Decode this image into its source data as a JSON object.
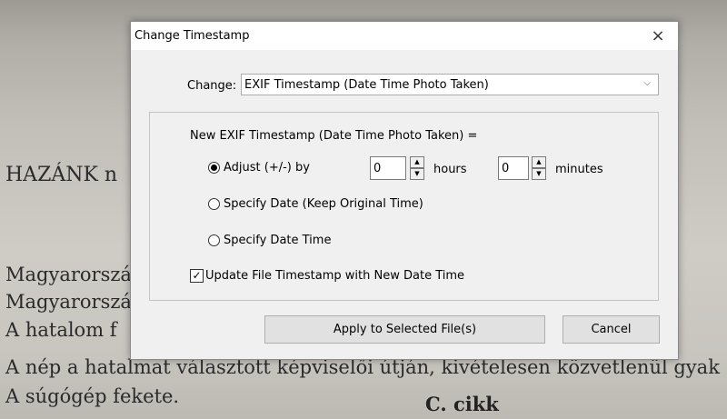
{
  "background": {
    "heading": "HAZÁNK n",
    "lines": [
      "Magyarorszá",
      "Magyarorszá",
      "A hatalom f",
      "A nép a hatalmat választott képviselői útján, kivételesen közvetlenül gyak",
      "A súgógép fekete."
    ],
    "article": "C. cikk"
  },
  "dialog": {
    "title": "Change Timestamp",
    "close_icon": "×",
    "change_label": "Change:",
    "change_select_value": "EXIF Timestamp (Date Time Photo Taken)",
    "select_arrow": "⌵",
    "group_title": "New EXIF Timestamp (Date Time Photo Taken)  =",
    "options": {
      "adjust": "Adjust (+/-) by",
      "specify_date": "Specify Date (Keep Original Time)",
      "specify_datetime": "Specify Date Time"
    },
    "selected_option": "adjust",
    "hours_value": "0",
    "hours_label": "hours",
    "minutes_value": "0",
    "minutes_label": "minutes",
    "spin_up": "▲",
    "spin_down": "▼",
    "update_checkbox_label": "Update File Timestamp with New Date Time",
    "update_checkbox_checked": true,
    "check_mark": "✓",
    "apply_button": "Apply to Selected File(s)",
    "cancel_button": "Cancel"
  }
}
